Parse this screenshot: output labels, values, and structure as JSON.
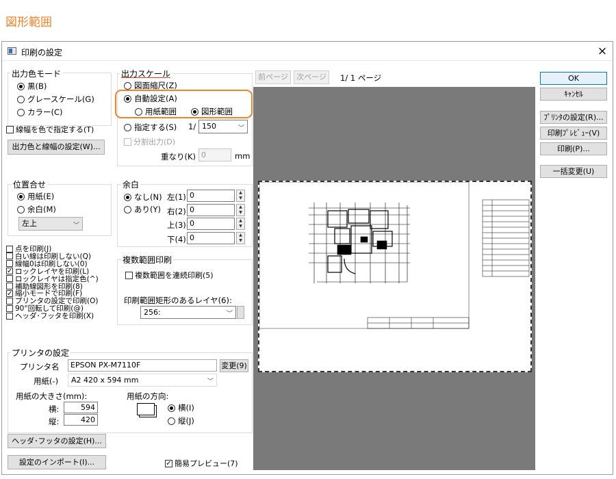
{
  "page_heading": "図形範囲",
  "dialog": {
    "title": "印刷の設定",
    "close": "×"
  },
  "output_color_mode": {
    "label": "出力色モード",
    "options": [
      "黒(B)",
      "グレースケール(G)",
      "カラー(C)"
    ],
    "selected": "黒(B)"
  },
  "line_width_color_check": "線幅を色で指定する(T)",
  "output_color_button": "出力色と線幅の設定(W)...",
  "output_scale": {
    "label": "出力スケール",
    "opt_figure_scale": "図面縮尺(Z)",
    "opt_auto": "自動設定(A)",
    "sub_paper_range": "用紙範囲",
    "sub_figure_range": "図形範囲",
    "opt_specify": "指定する(S)",
    "scale_prefix": "1/",
    "scale_value": "150",
    "split_output": "分割出力(D)",
    "overlap_label": "重なり(K)",
    "overlap_value": "0",
    "overlap_unit": "mm"
  },
  "position": {
    "label": "位置合せ",
    "opt_paper": "用紙(E)",
    "opt_margin": "余白(M)",
    "align_value": "左上"
  },
  "margin": {
    "label": "余白",
    "opt_none": "なし(N)",
    "opt_some": "あり(Y)",
    "left_label": "左(1)",
    "right_label": "右(2)",
    "top_label": "上(3)",
    "bottom_label": "下(4)",
    "left": "0",
    "right": "0",
    "top": "0",
    "bottom": "0"
  },
  "options": [
    {
      "label": "点を印刷(J)",
      "checked": false
    },
    {
      "label": "白い線は印刷しない(Q)",
      "checked": false
    },
    {
      "label": "線幅0は印刷しない(0)",
      "checked": false
    },
    {
      "label": "ロックレイヤを印刷(L)",
      "checked": true
    },
    {
      "label": "ロックレイヤは指定色(^)",
      "checked": false
    },
    {
      "label": "補助線図形を印刷(8)",
      "checked": false
    },
    {
      "label": "縮小モードで印刷(F)",
      "checked": true
    },
    {
      "label": "プリンタの設定で印刷(O)",
      "checked": false
    },
    {
      "label": "90°回転して印刷(@)",
      "checked": false
    },
    {
      "label": "ヘッダ･フッタを印刷(X)",
      "checked": false
    }
  ],
  "multi_range": {
    "label": "複数範囲印刷",
    "continuous_check": "複数範囲を連続印刷(5)",
    "layer_label": "印刷範囲矩形のあるレイヤ(6):",
    "layer_value": "256:"
  },
  "printer": {
    "label": "プリンタの設定",
    "name_label": "プリンタ名",
    "name_value": "EPSON PX-M7110F",
    "change_button": "変更(9)",
    "paper_label": "用紙(-)",
    "paper_value": "A2 420 x 594 mm",
    "size_label": "用紙の大きさ(mm):",
    "width_label": "横:",
    "width_value": "594",
    "height_label": "縦:",
    "height_value": "420",
    "orient_label": "用紙の方向:",
    "orient_landscape": "横(I)",
    "orient_portrait": "縦(J)"
  },
  "header_footer_button": "ヘッダ･フッタの設定(H)...",
  "import_button": "設定のインポート(I)...",
  "simple_preview_check": "簡易プレビュー(7)",
  "preview_nav": {
    "prev": "前ページ",
    "next": "次ページ",
    "page_info": "1/  1 ページ"
  },
  "buttons": {
    "ok": "OK",
    "cancel": "ｷｬﾝｾﾙ",
    "printer_setup": "ﾌﾟﾘﾝﾀの設定(R)...",
    "print_preview": "印刷ﾌﾟﾚﾋﾞｭｰ(V)",
    "print": "印刷(P)...",
    "batch_change": "一括変更(U)"
  },
  "accent_color": "#f08228"
}
